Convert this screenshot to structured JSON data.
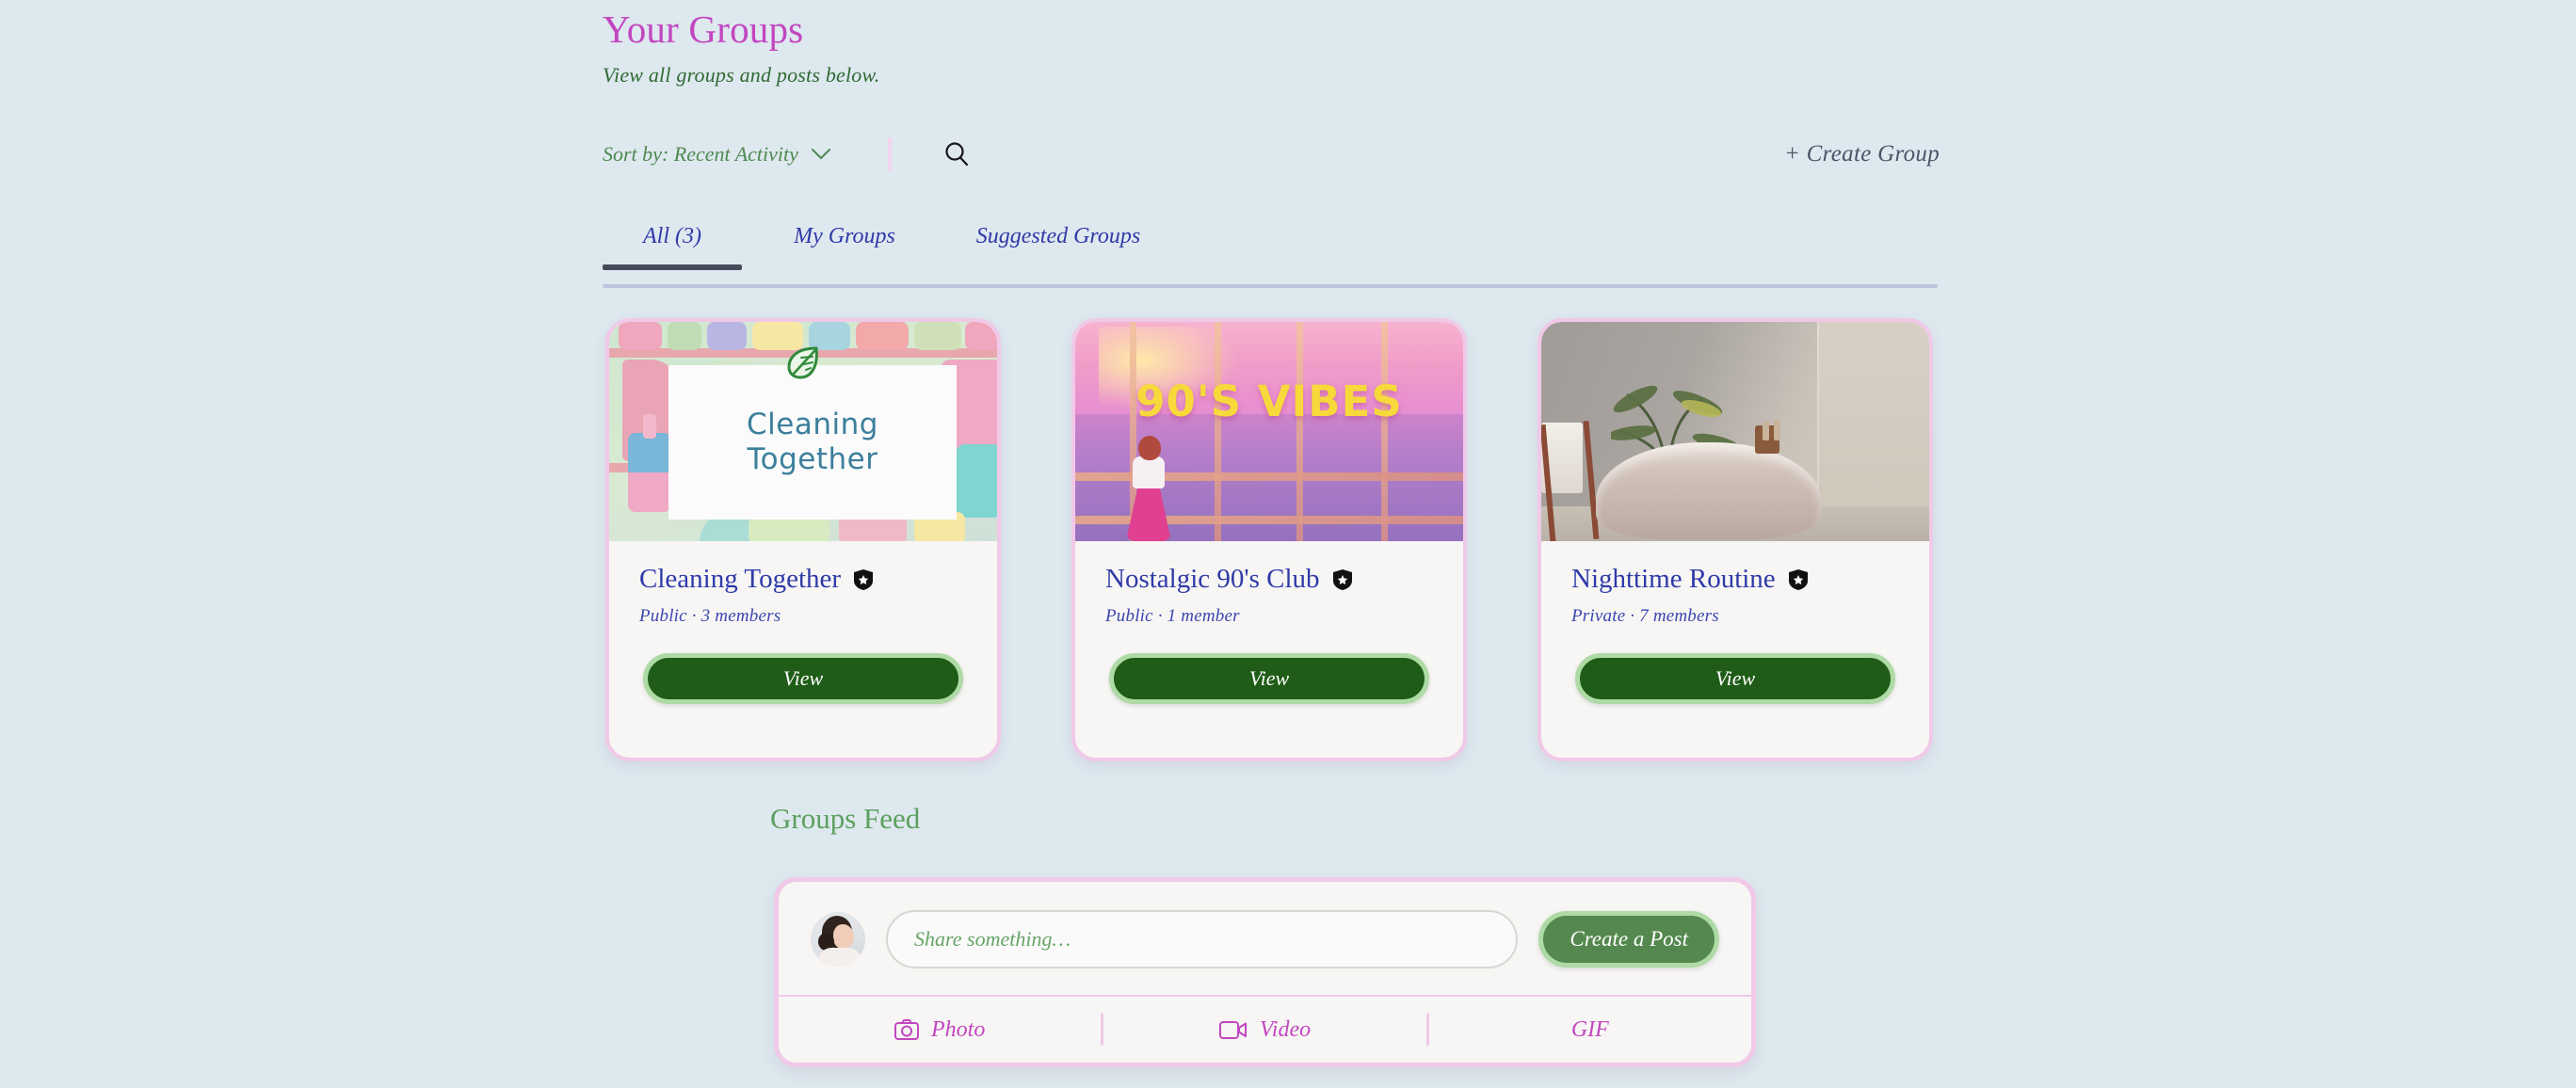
{
  "theme": {
    "background": "#dee8ef",
    "title_color": "#c246c0",
    "subtitle_color": "#2f6b33",
    "tab_color": "#2f3aa8",
    "card_border": "#f0c9e8",
    "card_bg": "#f7f6f4",
    "view_button_bg": "#1f5c17",
    "view_button_ring": "#aedaa5",
    "create_post_bg": "#54884e",
    "accent_pink": "#f3d4ee",
    "feed_heading_color": "#5ca05d"
  },
  "header": {
    "title": "Your Groups",
    "subtitle": "View all groups and posts below."
  },
  "controls": {
    "sort_label": "Sort by: Recent Activity",
    "sort_icon": "chevron-down-icon",
    "search_icon": "search-icon",
    "create_group_label": "+ Create Group"
  },
  "tabs": [
    {
      "label": "All (3)",
      "active": true
    },
    {
      "label": "My Groups",
      "active": false
    },
    {
      "label": "Suggested Groups",
      "active": false
    }
  ],
  "groups": [
    {
      "name": "Cleaning Together",
      "meta": "Public · 3 members",
      "privacy": "Public",
      "members": "3 members",
      "badge_icon": "shield-check-icon",
      "view_label": "View",
      "cover": {
        "kind": "illustration",
        "alt": "Pastel illustration of cleaning supply bottles on shelves",
        "label_line1": "Cleaning",
        "label_line2": "Together",
        "label_color": "#3c7f9c",
        "leaf_icon": "leaf-icon"
      }
    },
    {
      "name": "Nostalgic 90's Club",
      "meta": "Public · 1 member",
      "privacy": "Public",
      "members": "1 member",
      "badge_icon": "shield-check-icon",
      "view_label": "View",
      "cover": {
        "kind": "illustration",
        "alt": "Anime style pink sunset city skyline seen through windows",
        "overlay_text": "90'S VIBES",
        "overlay_color": "#f7d93b"
      }
    },
    {
      "name": "Nighttime Routine",
      "meta": "Private · 7 members",
      "privacy": "Private",
      "members": "7 members",
      "badge_icon": "shield-check-icon",
      "view_label": "View",
      "cover": {
        "kind": "photo",
        "alt": "Spa bathroom with freestanding bathtub, palm plant and stone wall"
      }
    }
  ],
  "feed": {
    "heading": "Groups Feed",
    "composer": {
      "avatar_alt": "User profile photo",
      "input_placeholder": "Share something…",
      "input_value": "",
      "submit_label": "Create a Post",
      "actions": [
        {
          "label": "Photo",
          "icon": "camera-icon"
        },
        {
          "label": "Video",
          "icon": "video-camera-icon"
        },
        {
          "label": "GIF",
          "icon": "gif-icon"
        }
      ]
    }
  }
}
